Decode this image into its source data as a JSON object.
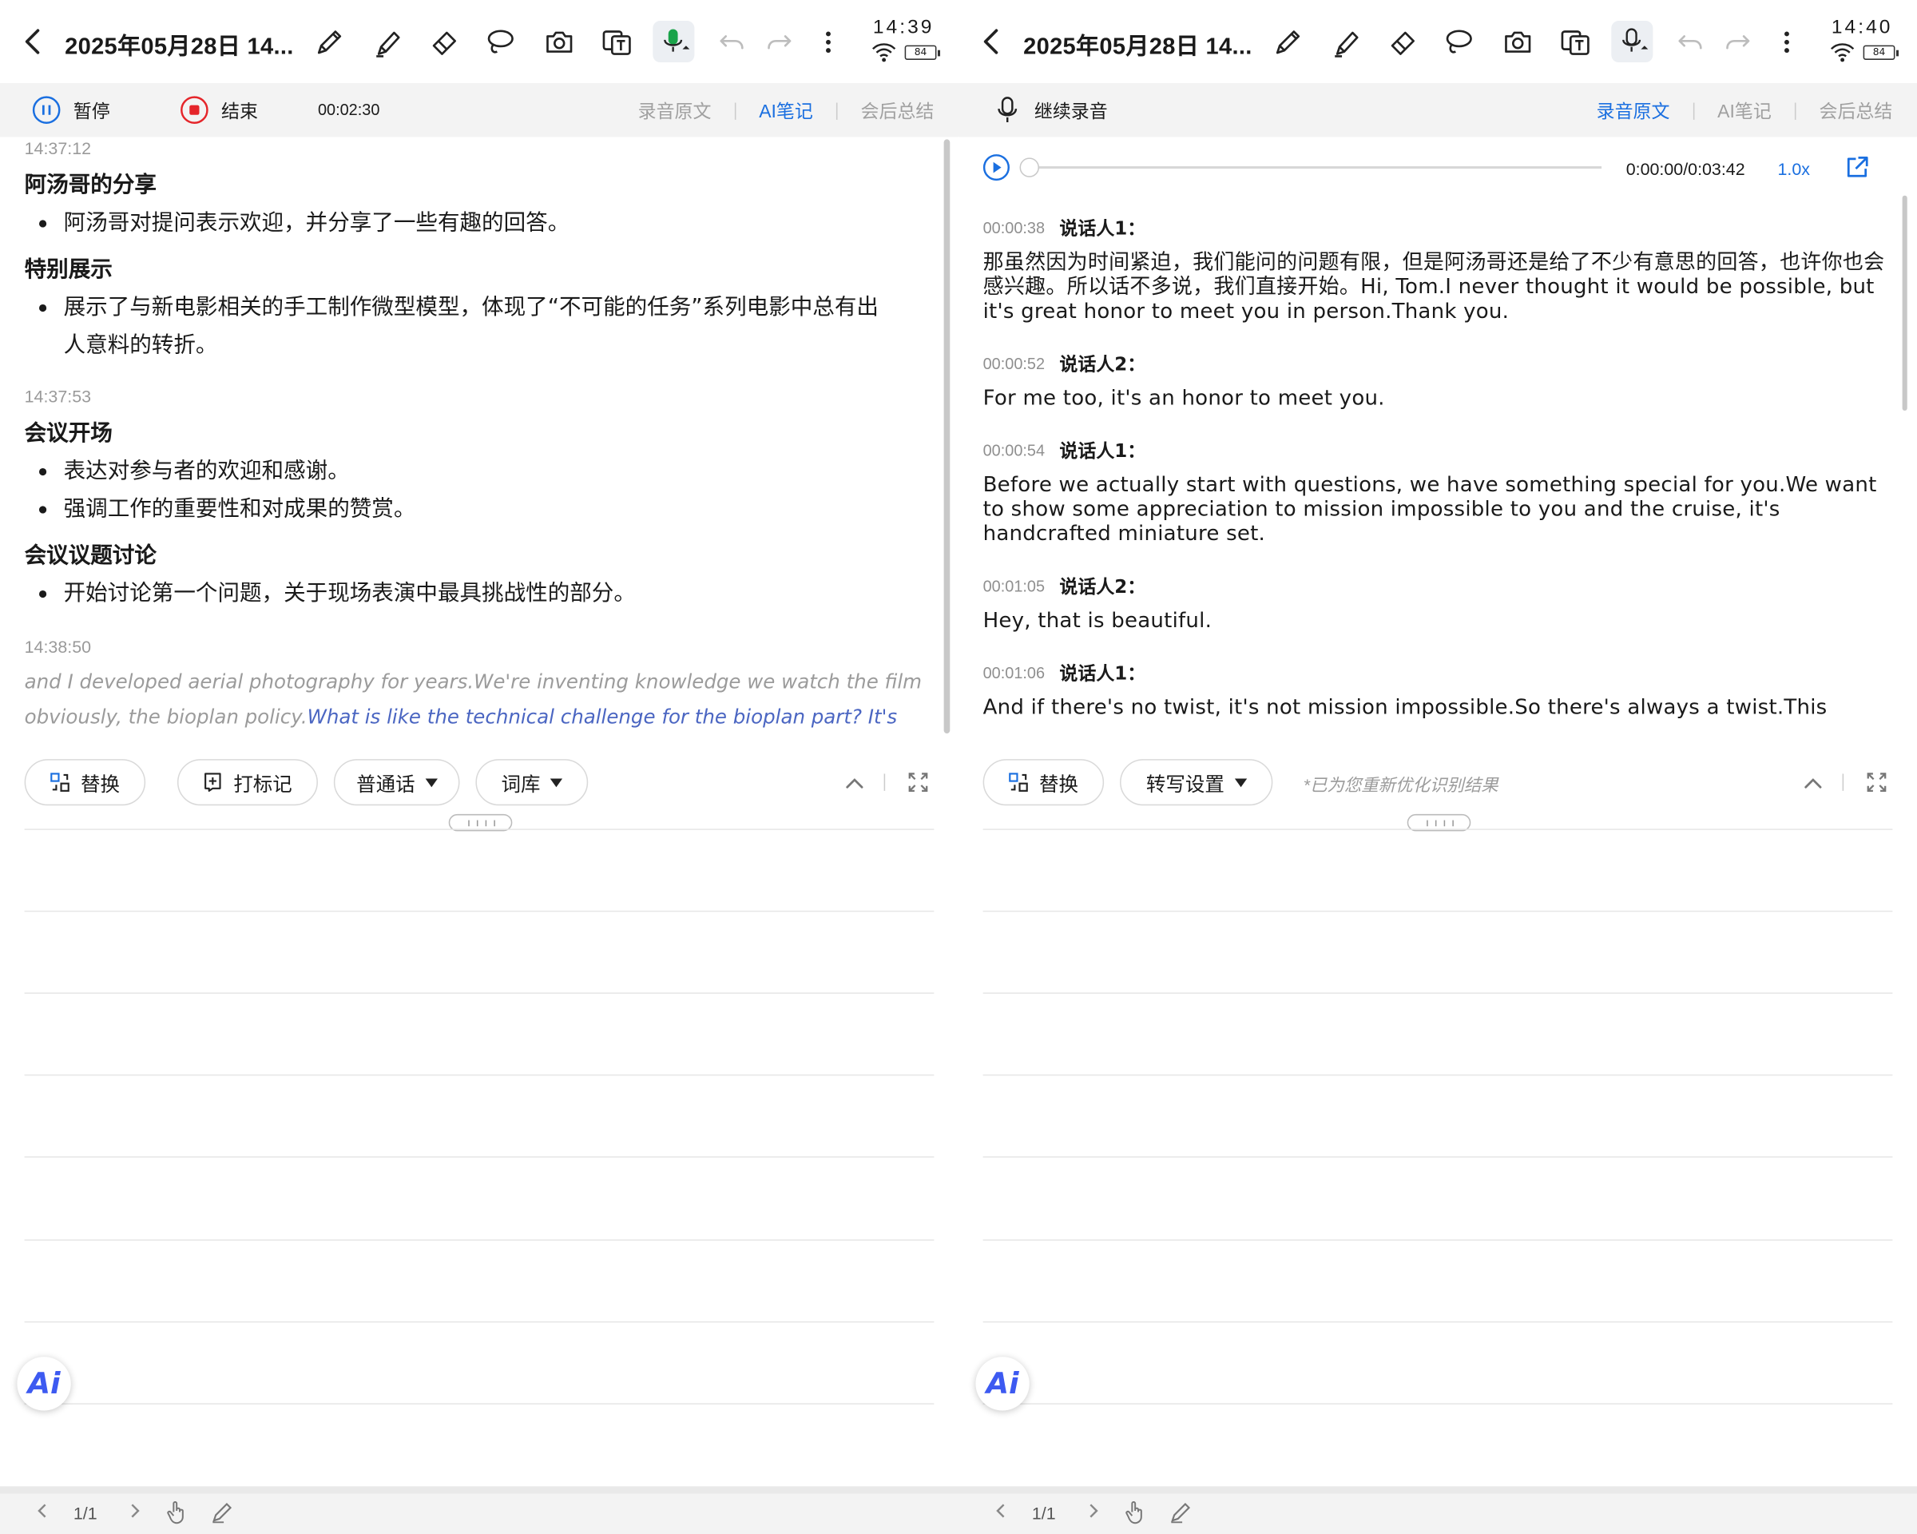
{
  "left": {
    "title": "2025年05月28日 14...",
    "clock": "14:39",
    "battery": "84",
    "pause_label": "暂停",
    "stop_label": "结束",
    "timer": "00:02:30",
    "tabs": [
      "录音原文",
      "AI笔记",
      "会后总结"
    ],
    "active_tab": "AI笔记",
    "notes": {
      "t1": "14:37:12",
      "h1": "阿汤哥的分享",
      "b1": "阿汤哥对提问表示欢迎，并分享了一些有趣的回答。",
      "h2": "特别展示",
      "b2a": "展示了与新电影相关的手工制作微型模型，体现了“不可能的任务”系列电影中总有出",
      "b2b": "人意料的转折。",
      "t2": "14:37:53",
      "h3": "会议开场",
      "b3": "表达对参与者的欢迎和感谢。",
      "b4": "强调工作的重要性和对成果的赞赏。",
      "h4": "会议议题讨论",
      "b5": "开始讨论第一个问题，关于现场表演中最具挑战性的部分。",
      "t3": "14:38:50",
      "live_gray": "and I developed aerial photography for years.We're inventing knowledge we watch the film obviously, the bioplan policy.",
      "live_blue": "What is like the technical challenge for the bioplan part? It's incredible."
    },
    "toolbar": {
      "replace": "替换",
      "mark": "打标记",
      "language": "普通话",
      "lexicon": "词库"
    },
    "page": "1/1"
  },
  "right": {
    "title": "2025年05月28日 14...",
    "clock": "14:40",
    "battery": "84",
    "resume_label": "继续录音",
    "tabs": [
      "录音原文",
      "AI笔记",
      "会后总结"
    ],
    "active_tab": "录音原文",
    "player": {
      "time": "0:00:00/0:03:42",
      "speed": "1.0x"
    },
    "transcript": [
      {
        "time": "00:00:38",
        "speaker": "说话人1：",
        "text": "那虽然因为时间紧迫，我们能问的问题有限，但是阿汤哥还是给了不少有意思的回答，也许你也会感兴趣。所以话不多说，我们直接开始。Hi, Tom.I never thought it would be possible, but it's great honor to meet you in person.Thank you."
      },
      {
        "time": "00:00:52",
        "speaker": "说话人2：",
        "text": "For me too, it's an honor to meet you."
      },
      {
        "time": "00:00:54",
        "speaker": "说话人1：",
        "text": "Before we actually start with questions, we have something special for you.We want to show some appreciation to mission impossible to you and the cruise, it's handcrafted miniature set."
      },
      {
        "time": "00:01:05",
        "speaker": "说话人2：",
        "text": "Hey, that is beautiful."
      },
      {
        "time": "00:01:06",
        "speaker": "说话人1：",
        "text": "And if there's no twist, it's not mission impossible.So there's always a twist.This"
      }
    ],
    "toolbar": {
      "replace": "替换",
      "transcribe_settings": "转写设置",
      "hint": "*已为您重新优化识别结果"
    },
    "page": "1/1"
  },
  "ai_button": "Ai",
  "colors": {
    "accent": "#1a6fe0",
    "stop_red": "#e5252a",
    "mic_green": "#1aa34a",
    "live_blue": "#4b66c2"
  }
}
